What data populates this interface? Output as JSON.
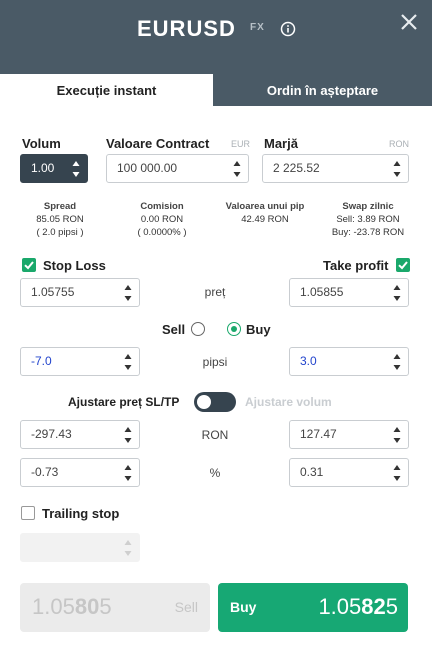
{
  "header": {
    "symbol": "EURUSD",
    "badge": "FX"
  },
  "tabs": {
    "instant": "Execuție instant",
    "pending": "Ordin în așteptare"
  },
  "volume": {
    "label": "Volum",
    "value": "1.00"
  },
  "contract": {
    "label": "Valoare Contract",
    "currency": "EUR",
    "value": "100 000.00"
  },
  "margin": {
    "label": "Marjă",
    "currency": "RON",
    "value": "2 225.52"
  },
  "stats": {
    "spread": {
      "label": "Spread",
      "line1": "85.05 RON",
      "line2": "( 2.0 pipsi )"
    },
    "commission": {
      "label": "Comision",
      "line1": "0.00 RON",
      "line2": "( 0.0000% )"
    },
    "pip": {
      "label": "Valoarea unui pip",
      "line1": "42.49 RON"
    },
    "swap": {
      "label": "Swap zilnic",
      "line1": "Sell: 3.89 RON",
      "line2": "Buy: -23.78 RON"
    }
  },
  "stop_loss": {
    "label": "Stop Loss",
    "checked": true,
    "price": "1.05755",
    "pips": "-7.0",
    "ron": "-297.43",
    "percent": "-0.73"
  },
  "take_profit": {
    "label": "Take profit",
    "checked": true,
    "price": "1.05855",
    "pips": "3.0",
    "ron": "127.47",
    "percent": "0.31"
  },
  "row_labels": {
    "price": "preț",
    "pips": "pipsi",
    "ron": "RON",
    "percent": "%"
  },
  "direction": {
    "sell": "Sell",
    "buy": "Buy",
    "selected": "Buy"
  },
  "adjust": {
    "price_label": "Ajustare preț SL/TP",
    "volume_label": "Ajustare volum"
  },
  "trailing": {
    "label": "Trailing stop",
    "checked": false
  },
  "buttons": {
    "sell": {
      "label": "Sell",
      "price_pre": "1.05",
      "price_big": "80",
      "price_post": "5"
    },
    "buy": {
      "label": "Buy",
      "price_pre": "1.05",
      "price_big": "82",
      "price_post": "5"
    }
  },
  "colors": {
    "header": "#4a5a66",
    "accent": "#17a874",
    "dark_input": "#36444f"
  }
}
